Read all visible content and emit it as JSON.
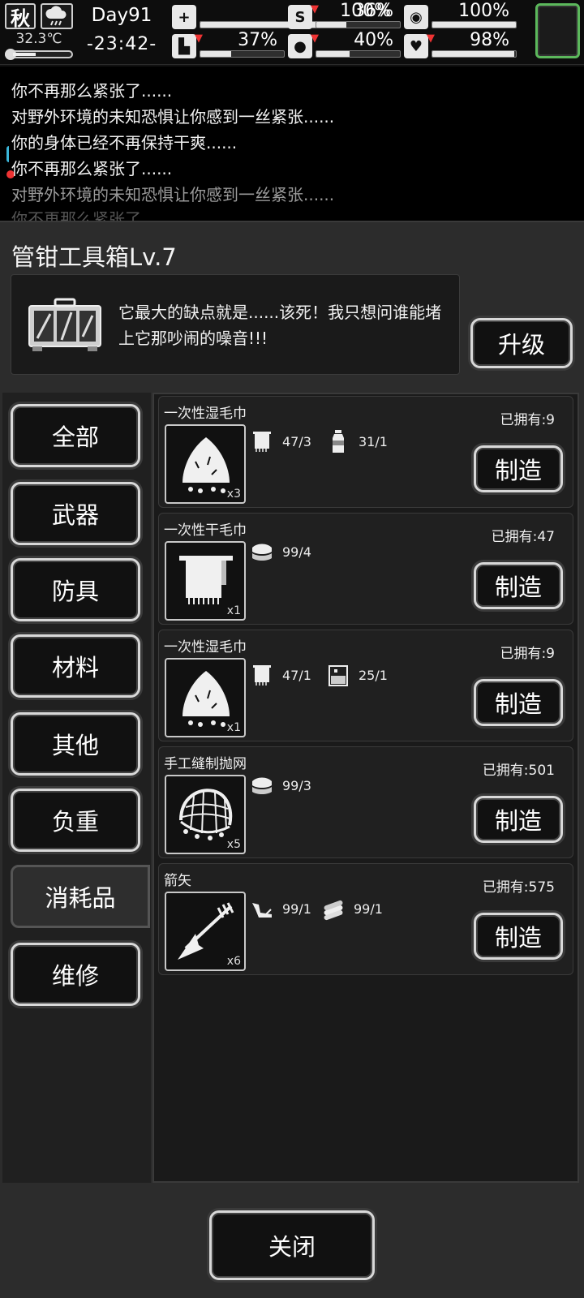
{
  "status": {
    "season": "秋",
    "temperature": "32.3℃",
    "temperature_level": 0.4,
    "day": "Day91",
    "time": "-23:42-",
    "stats": [
      {
        "id": "health",
        "icon": "medkit-icon",
        "value": "100%",
        "level": 1.0,
        "down": false
      },
      {
        "id": "hunger",
        "icon": "stomach-icon",
        "value": "36%",
        "level": 0.36,
        "down": true
      },
      {
        "id": "sanity",
        "icon": "brain-icon",
        "value": "100%",
        "level": 1.0,
        "down": false
      },
      {
        "id": "stamina",
        "icon": "boot-icon",
        "value": "37%",
        "level": 0.37,
        "down": true
      },
      {
        "id": "thirst",
        "icon": "water-drop-icon",
        "value": "40%",
        "level": 0.4,
        "down": true
      },
      {
        "id": "mood",
        "icon": "heart-icon",
        "value": "98%",
        "level": 0.98,
        "down": true
      }
    ],
    "minimap_border_color": "#5cb85c"
  },
  "log": [
    "你不再那么紧张了......",
    "对野外环境的未知恐惧让你感到一丝紧张......",
    "你的身体已经不再保持干爽......",
    "你不再那么紧张了......",
    "对野外环境的未知恐惧让你感到一丝紧张......",
    "你不再那么紧张了......"
  ],
  "panel": {
    "title": "管钳工具箱Lv.7",
    "description": "它最大的缺点就是......该死！我只想问谁能堵上它那吵闹的噪音!!!",
    "upgrade_label": "升级",
    "close_label": "关闭"
  },
  "categories": [
    "全部",
    "武器",
    "防具",
    "材料",
    "其他",
    "负重",
    "消耗品",
    "维修"
  ],
  "active_category": "消耗品",
  "recipes": [
    {
      "name": "一次性湿毛巾",
      "owned": "已拥有:9",
      "qty": "x3",
      "icon": "wet-towel-icon",
      "materials": [
        {
          "icon": "towel-icon",
          "text": "47/3"
        },
        {
          "icon": "water-bottle-icon",
          "text": "31/1"
        }
      ],
      "make_label": "制造"
    },
    {
      "name": "一次性干毛巾",
      "owned": "已拥有:47",
      "qty": "x1",
      "icon": "dry-towel-icon",
      "materials": [
        {
          "icon": "cloth-pile-icon",
          "text": "99/4"
        }
      ],
      "make_label": "制造"
    },
    {
      "name": "一次性湿毛巾",
      "owned": "已拥有:9",
      "qty": "x1",
      "icon": "wet-towel-icon",
      "materials": [
        {
          "icon": "towel-icon",
          "text": "47/1"
        },
        {
          "icon": "water-tank-icon",
          "text": "25/1"
        }
      ],
      "make_label": "制造"
    },
    {
      "name": "手工缝制抛网",
      "owned": "已拥有:501",
      "qty": "x5",
      "icon": "cast-net-icon",
      "materials": [
        {
          "icon": "cloth-pile-icon",
          "text": "99/3"
        }
      ],
      "make_label": "制造"
    },
    {
      "name": "箭矢",
      "owned": "已拥有:575",
      "qty": "x6",
      "icon": "arrow-icon",
      "materials": [
        {
          "icon": "feather-icon",
          "text": "99/1"
        },
        {
          "icon": "logs-icon",
          "text": "99/1"
        }
      ],
      "make_label": "制造"
    }
  ]
}
